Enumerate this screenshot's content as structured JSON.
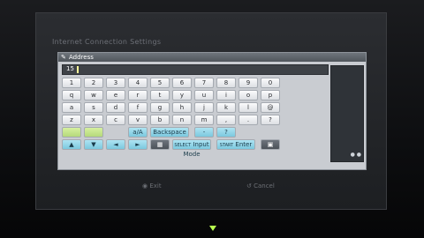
{
  "screen": {
    "title": "Internet Connection Settings",
    "panel": {
      "header_label": "Address",
      "field_value": "15"
    },
    "keyboard": {
      "row1": [
        "1",
        "2",
        "3",
        "4",
        "5",
        "6",
        "7",
        "8",
        "9",
        "0"
      ],
      "row2": [
        "q",
        "w",
        "e",
        "r",
        "t",
        "y",
        "u",
        "i",
        "o",
        "p"
      ],
      "row3": [
        "a",
        "s",
        "d",
        "f",
        "g",
        "h",
        "j",
        "k",
        "l",
        "@"
      ],
      "row4": [
        "z",
        "x",
        "c",
        "v",
        "b",
        "n",
        "m",
        ",",
        ".",
        "?"
      ],
      "row5": {
        "caps": "",
        "sym": "",
        "aa": "a/A",
        "backspace": "Backspace",
        "dash": "-",
        "slash": "?"
      },
      "row6": {
        "up": "▲",
        "down": "▼",
        "left": "◄",
        "right": "►",
        "grid": "▦",
        "input_mode_tag": "SELECT",
        "input_mode": "Input Mode",
        "enter_tag": "START",
        "enter": "Enter",
        "chat": "▣"
      }
    },
    "footer": {
      "exit": "Exit",
      "cancel": "Cancel"
    }
  }
}
